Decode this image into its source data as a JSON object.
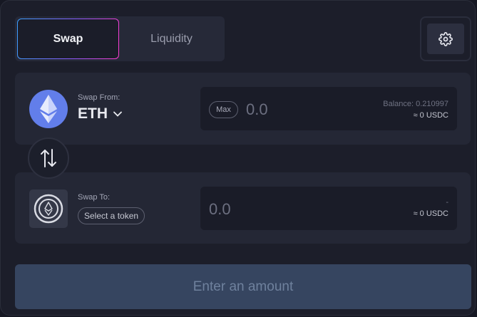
{
  "tabs": {
    "swap_label": "Swap",
    "liquidity_label": "Liquidity"
  },
  "settings": {
    "icon": "gear-icon"
  },
  "from": {
    "label": "Swap From:",
    "token": "ETH",
    "token_icon": "ethereum-icon",
    "max_label": "Max",
    "amount_placeholder": "0.0",
    "balance": "Balance: 0.210997",
    "usd_value": "≈ 0 USDC"
  },
  "switch": {
    "icon": "swap-arrows-icon"
  },
  "to": {
    "label": "Swap To:",
    "token_icon": "token-placeholder-icon",
    "select_label": "Select a token",
    "amount_placeholder": "0.0",
    "balance": "-",
    "usd_value": "≈ 0 USDC"
  },
  "action": {
    "label": "Enter an amount"
  },
  "colors": {
    "background": "#1c1e2a",
    "panel": "#242735",
    "input_box": "#1a1c28",
    "eth_blue": "#627eea",
    "action_button": "#364560",
    "tab_gradient_start": "#3aa0ff",
    "tab_gradient_end": "#ff3bd0"
  }
}
